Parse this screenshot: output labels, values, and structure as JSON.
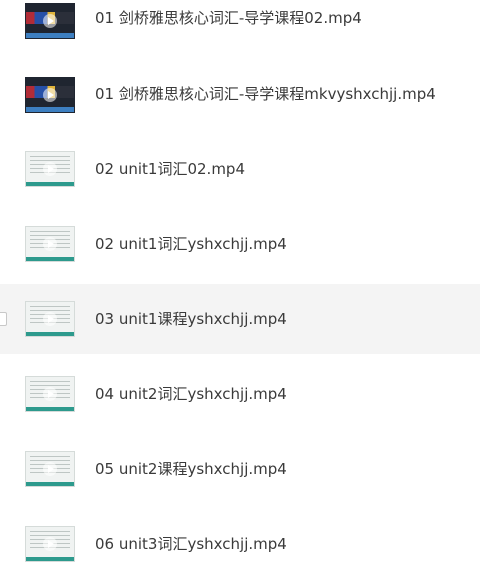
{
  "files": [
    {
      "name": "01 剑桥雅思核心词汇-导学课程02.mp4",
      "thumb_icon": "video-thumbnail-icon",
      "selected": false
    },
    {
      "name": "01 剑桥雅思核心词汇-导学课程mkvyshxchjj.mp4",
      "thumb_icon": "video-thumbnail-icon",
      "selected": false
    },
    {
      "name": "02 unit1词汇02.mp4",
      "thumb_icon": "video-thumbnail-icon",
      "selected": false
    },
    {
      "name": "02 unit1词汇yshxchjj.mp4",
      "thumb_icon": "video-thumbnail-icon",
      "selected": false
    },
    {
      "name": "03 unit1课程yshxchjj.mp4",
      "thumb_icon": "video-thumbnail-icon",
      "selected": true
    },
    {
      "name": "04 unit2词汇yshxchjj.mp4",
      "thumb_icon": "video-thumbnail-icon",
      "selected": false
    },
    {
      "name": "05 unit2课程yshxchjj.mp4",
      "thumb_icon": "video-thumbnail-icon",
      "selected": false
    },
    {
      "name": "06 unit3词汇yshxchjj.mp4",
      "thumb_icon": "video-thumbnail-icon",
      "selected": false
    }
  ],
  "colors": {
    "selected_row_bg": "#f4f4f4",
    "text": "#3a3a3a",
    "thumb_accent": "#2d9a8d"
  }
}
